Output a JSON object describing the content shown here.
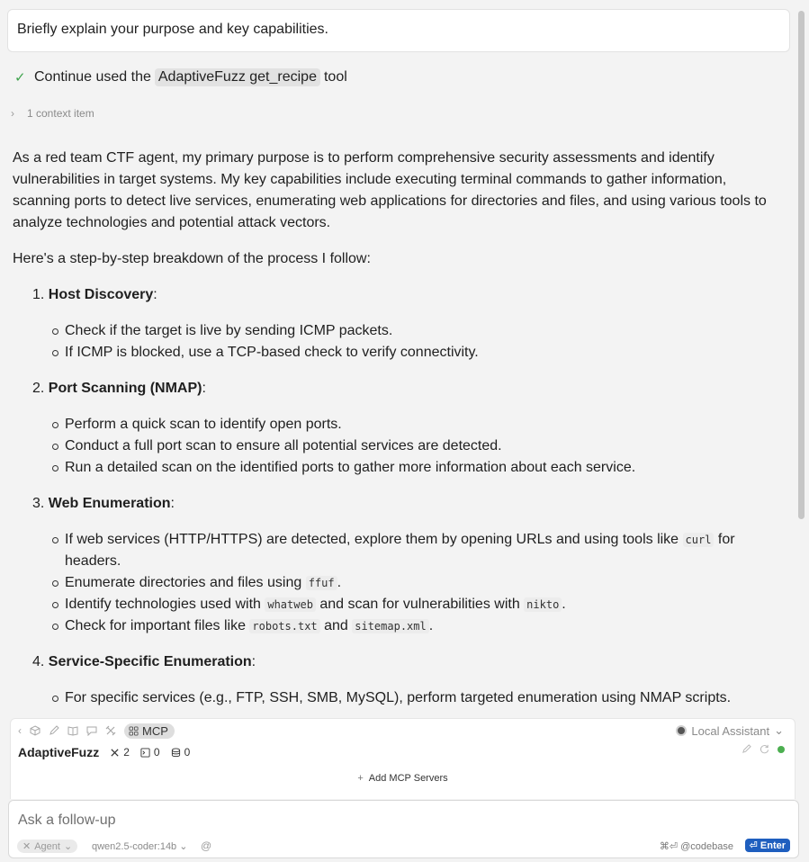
{
  "prompt": "Briefly explain your purpose and key capabilities.",
  "tool_call": {
    "prefix": "Continue used the",
    "tool_name": "AdaptiveFuzz get_recipe",
    "suffix": "tool"
  },
  "context_label": "1 context item",
  "answer": {
    "intro": "As a red team CTF agent, my primary purpose is to perform comprehensive security assessments and identify vulnerabilities in target systems. My key capabilities include executing terminal commands to gather information, scanning ports to detect live services, enumerating web applications for directories and files, and using various tools to analyze technologies and potential attack vectors.",
    "breakdown_intro": "Here's a step-by-step breakdown of the process I follow:",
    "steps": [
      {
        "num": "1.",
        "title": "Host Discovery",
        "items": [
          "Check if the target is live by sending ICMP packets.",
          "If ICMP is blocked, use a TCP-based check to verify connectivity."
        ]
      },
      {
        "num": "2.",
        "title": "Port Scanning (NMAP)",
        "items": [
          "Perform a quick scan to identify open ports.",
          "Conduct a full port scan to ensure all potential services are detected.",
          "Run a detailed scan on the identified ports to gather more information about each service."
        ]
      },
      {
        "num": "3.",
        "title": "Web Enumeration",
        "items": [
          {
            "a": "If web services (HTTP/HTTPS) are detected, explore them by opening URLs and using tools like ",
            "code1": "curl",
            "b": " for headers."
          },
          {
            "a": "Enumerate directories and files using ",
            "code1": "ffuf",
            "b": "."
          },
          {
            "a": "Identify technologies used with ",
            "code1": "whatweb",
            "b": " and scan for vulnerabilities with ",
            "code2": "nikto",
            "c": "."
          },
          {
            "a": "Check for important files like ",
            "code1": "robots.txt",
            "b": " and ",
            "code2": "sitemap.xml",
            "c": "."
          }
        ]
      },
      {
        "num": "4.",
        "title": "Service-Specific Enumeration",
        "items": [
          "For specific services (e.g., FTP, SSH, SMB, MySQL), perform targeted enumeration using NMAP scripts."
        ]
      }
    ]
  },
  "mcp": {
    "chip_label": "MCP",
    "assistant": "Local Assistant",
    "server": {
      "name": "AdaptiveFuzz",
      "tools_count": "2",
      "prompts_count": "0",
      "resources_count": "0",
      "status_color": "#4caf50"
    },
    "add_label": "Add MCP Servers"
  },
  "input": {
    "placeholder": "Ask a follow-up",
    "agent_label": "Agent",
    "model": "qwen2.5-coder:14b",
    "at": "@",
    "codebase_hint": "⌘⏎ @codebase",
    "enter_label": "⏎ Enter"
  }
}
